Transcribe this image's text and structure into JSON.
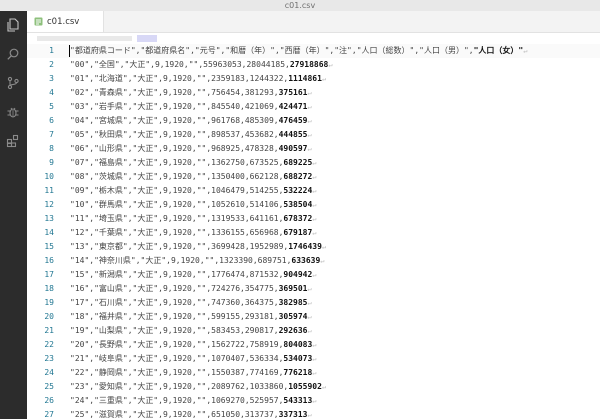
{
  "window": {
    "title": "c01.csv"
  },
  "activity_bar": {
    "icons": [
      "explorer-icon",
      "search-icon",
      "source-control-icon",
      "debug-icon",
      "extensions-icon"
    ],
    "bg_color": "#2c2c2c"
  },
  "tab": {
    "label": "c01.csv",
    "icon": "csv-file-icon"
  },
  "editor": {
    "eol_glyph": "↵",
    "lines": [
      {
        "no": "1",
        "pre": "\"都道府県コード\",\"都道府県名\",\"元号\",\"和暦（年）\",\"西暦（年）\",\"注\",\"人口（総数）\",\"人口（男）\",",
        "emph": "\"人口（女）\""
      },
      {
        "no": "2",
        "pre": "\"00\",\"全国\",\"大正\",9,1920,\"\",55963053,28044185,",
        "emph": "27918868"
      },
      {
        "no": "3",
        "pre": "\"01\",\"北海道\",\"大正\",9,1920,\"\",2359183,1244322,",
        "emph": "1114861"
      },
      {
        "no": "4",
        "pre": "\"02\",\"青森県\",\"大正\",9,1920,\"\",756454,381293,",
        "emph": "375161"
      },
      {
        "no": "5",
        "pre": "\"03\",\"岩手県\",\"大正\",9,1920,\"\",845540,421069,",
        "emph": "424471"
      },
      {
        "no": "6",
        "pre": "\"04\",\"宮城県\",\"大正\",9,1920,\"\",961768,485309,",
        "emph": "476459"
      },
      {
        "no": "7",
        "pre": "\"05\",\"秋田県\",\"大正\",9,1920,\"\",898537,453682,",
        "emph": "444855"
      },
      {
        "no": "8",
        "pre": "\"06\",\"山形県\",\"大正\",9,1920,\"\",968925,478328,",
        "emph": "490597"
      },
      {
        "no": "9",
        "pre": "\"07\",\"福島県\",\"大正\",9,1920,\"\",1362750,673525,",
        "emph": "689225"
      },
      {
        "no": "10",
        "pre": "\"08\",\"茨城県\",\"大正\",9,1920,\"\",1350400,662128,",
        "emph": "688272"
      },
      {
        "no": "11",
        "pre": "\"09\",\"栃木県\",\"大正\",9,1920,\"\",1046479,514255,",
        "emph": "532224"
      },
      {
        "no": "12",
        "pre": "\"10\",\"群馬県\",\"大正\",9,1920,\"\",1052610,514106,",
        "emph": "538504"
      },
      {
        "no": "13",
        "pre": "\"11\",\"埼玉県\",\"大正\",9,1920,\"\",1319533,641161,",
        "emph": "678372"
      },
      {
        "no": "14",
        "pre": "\"12\",\"千葉県\",\"大正\",9,1920,\"\",1336155,656968,",
        "emph": "679187"
      },
      {
        "no": "15",
        "pre": "\"13\",\"東京都\",\"大正\",9,1920,\"\",3699428,1952989,",
        "emph": "1746439"
      },
      {
        "no": "16",
        "pre": "\"14\",\"神奈川県\",\"大正\",9,1920,\"\",1323390,689751,",
        "emph": "633639"
      },
      {
        "no": "17",
        "pre": "\"15\",\"新潟県\",\"大正\",9,1920,\"\",1776474,871532,",
        "emph": "904942"
      },
      {
        "no": "18",
        "pre": "\"16\",\"富山県\",\"大正\",9,1920,\"\",724276,354775,",
        "emph": "369501"
      },
      {
        "no": "19",
        "pre": "\"17\",\"石川県\",\"大正\",9,1920,\"\",747360,364375,",
        "emph": "382985"
      },
      {
        "no": "20",
        "pre": "\"18\",\"福井県\",\"大正\",9,1920,\"\",599155,293181,",
        "emph": "305974"
      },
      {
        "no": "21",
        "pre": "\"19\",\"山梨県\",\"大正\",9,1920,\"\",583453,290817,",
        "emph": "292636"
      },
      {
        "no": "22",
        "pre": "\"20\",\"長野県\",\"大正\",9,1920,\"\",1562722,758919,",
        "emph": "804083"
      },
      {
        "no": "23",
        "pre": "\"21\",\"岐阜県\",\"大正\",9,1920,\"\",1070407,536334,",
        "emph": "534073"
      },
      {
        "no": "24",
        "pre": "\"22\",\"静岡県\",\"大正\",9,1920,\"\",1550387,774169,",
        "emph": "776218"
      },
      {
        "no": "25",
        "pre": "\"23\",\"愛知県\",\"大正\",9,1920,\"\",2089762,1033860,",
        "emph": "1055902"
      },
      {
        "no": "26",
        "pre": "\"24\",\"三重県\",\"大正\",9,1920,\"\",1069270,525957,",
        "emph": "543313"
      },
      {
        "no": "27",
        "pre": "\"25\",\"滋賀県\",\"大正\",9,1920,\"\",651050,313737,",
        "emph": "337313"
      }
    ]
  }
}
